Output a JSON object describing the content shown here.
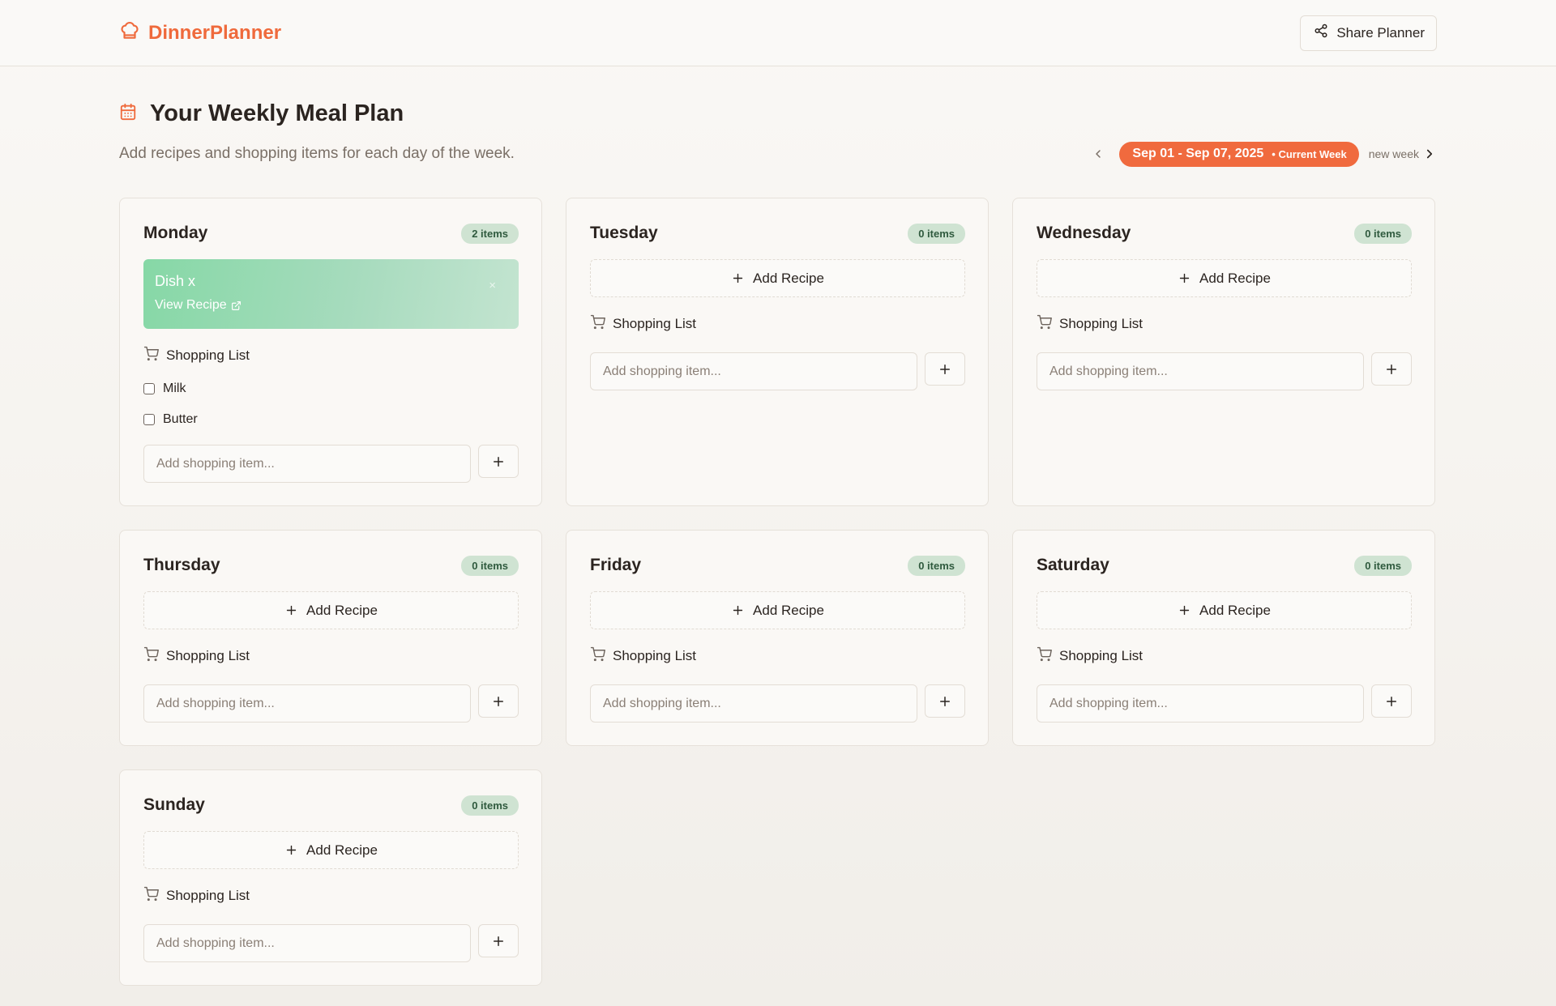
{
  "app": {
    "name": "DinnerPlanner",
    "share_label": "Share Planner"
  },
  "page": {
    "title": "Your Weekly Meal Plan",
    "subtitle": "Add recipes and shopping items for each day of the week."
  },
  "week": {
    "range": "Sep 01 - Sep 07, 2025",
    "current_label": "• Current Week",
    "next_label": "new week"
  },
  "labels": {
    "add_recipe": "Add Recipe",
    "shopping_list": "Shopping List",
    "add_item_placeholder": "Add shopping item...",
    "view_recipe": "View Recipe",
    "remove_glyph": "×"
  },
  "colors": {
    "accent": "#f06a3e",
    "badge_bg": "#cfe3d2",
    "recipe_green": "#86d8a6"
  },
  "days": [
    {
      "name": "Monday",
      "badge": "2 items",
      "recipe": {
        "name": "Dish x"
      },
      "items": [
        "Milk",
        "Butter"
      ]
    },
    {
      "name": "Tuesday",
      "badge": "0 items",
      "recipe": null,
      "items": []
    },
    {
      "name": "Wednesday",
      "badge": "0 items",
      "recipe": null,
      "items": []
    },
    {
      "name": "Thursday",
      "badge": "0 items",
      "recipe": null,
      "items": []
    },
    {
      "name": "Friday",
      "badge": "0 items",
      "recipe": null,
      "items": []
    },
    {
      "name": "Saturday",
      "badge": "0 items",
      "recipe": null,
      "items": []
    },
    {
      "name": "Sunday",
      "badge": "0 items",
      "recipe": null,
      "items": []
    }
  ]
}
